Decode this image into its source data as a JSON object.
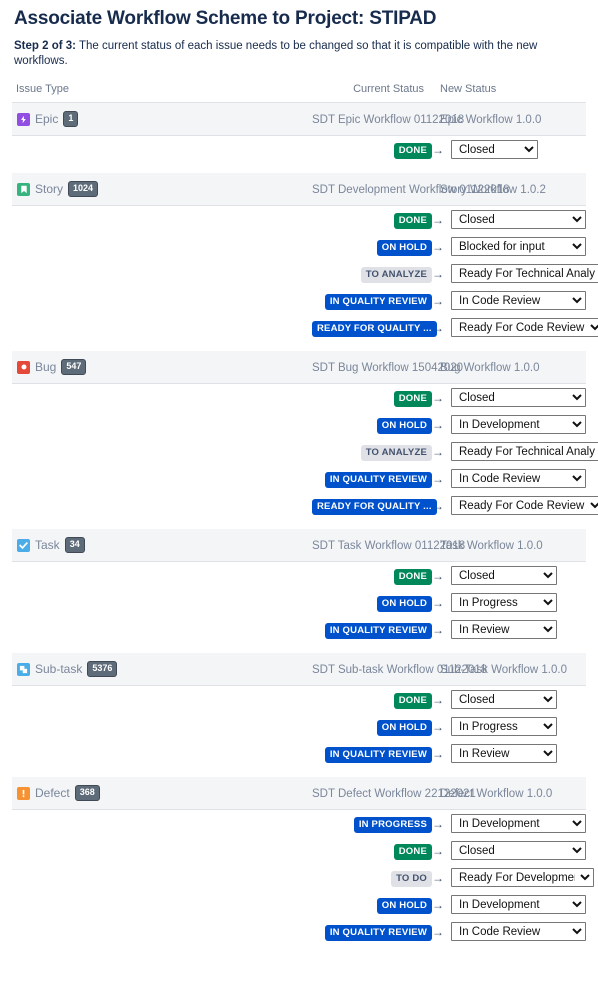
{
  "header": {
    "title": "Associate Workflow Scheme to Project: STIPAD",
    "step_label": "Step 2 of 3:",
    "step_text": " The current status of each issue needs to be changed so that it is compatible with the new workflows."
  },
  "columns": {
    "issue_type": "Issue Type",
    "current_status": "Current Status",
    "new_status": "New Status"
  },
  "colors": {
    "lozenge_green": "#00875a",
    "lozenge_blue": "#0052cc",
    "lozenge_grey": "#dfe1e6",
    "epic_icon": "#904ee2",
    "story_icon": "#36b37e",
    "bug_icon": "#e5493a",
    "task_icon": "#4bade8",
    "subtask_icon": "#4bade8",
    "defect_icon": "#f79232",
    "group_row_bg": "#f4f5f7",
    "muted_text": "#7a869a",
    "count_badge_bg": "#5e6c7a"
  },
  "groups": [
    {
      "type": "Epic",
      "icon": "epic-icon",
      "count": "1",
      "current_workflow": "SDT Epic Workflow 01122018",
      "new_workflow": "Epic Workflow 1.0.0",
      "select_width": "w-sm",
      "mappings": [
        {
          "status": "DONE",
          "tone": "green",
          "new_status": "Closed"
        }
      ]
    },
    {
      "type": "Story",
      "icon": "story-icon",
      "count": "1024",
      "current_workflow": "SDT Development Workflow 01122018",
      "new_workflow": "Story Workflow 1.0.2",
      "select_width": "w-xl",
      "mappings": [
        {
          "status": "DONE",
          "tone": "green",
          "new_status": "Closed"
        },
        {
          "status": "ON HOLD",
          "tone": "blue",
          "new_status": "Blocked for input"
        },
        {
          "status": "TO ANALYZE",
          "tone": "grey",
          "new_status": "Ready For Technical Analysis"
        },
        {
          "status": "IN QUALITY REVIEW",
          "tone": "blue",
          "new_status": "In Code Review"
        },
        {
          "status": "READY FOR QUALITY ...",
          "tone": "blue",
          "new_status": "Ready For Code Review"
        }
      ]
    },
    {
      "type": "Bug",
      "icon": "bug-icon",
      "count": "547",
      "current_workflow": "SDT Bug Workflow 15042020",
      "new_workflow": "Bug Workflow 1.0.0",
      "select_width": "w-xl",
      "mappings": [
        {
          "status": "DONE",
          "tone": "green",
          "new_status": "Closed"
        },
        {
          "status": "ON HOLD",
          "tone": "blue",
          "new_status": "In Development"
        },
        {
          "status": "TO ANALYZE",
          "tone": "grey",
          "new_status": "Ready For Technical Analysis"
        },
        {
          "status": "IN QUALITY REVIEW",
          "tone": "blue",
          "new_status": "In Code Review"
        },
        {
          "status": "READY FOR QUALITY ...",
          "tone": "blue",
          "new_status": "Ready For Code Review"
        }
      ]
    },
    {
      "type": "Task",
      "icon": "task-icon",
      "count": "34",
      "current_workflow": "SDT Task Workflow 01122018",
      "new_workflow": "Task Workflow 1.0.0",
      "select_width": "w-md",
      "mappings": [
        {
          "status": "DONE",
          "tone": "green",
          "new_status": "Closed"
        },
        {
          "status": "ON HOLD",
          "tone": "blue",
          "new_status": "In Progress"
        },
        {
          "status": "IN QUALITY REVIEW",
          "tone": "blue",
          "new_status": "In Review"
        }
      ]
    },
    {
      "type": "Sub-task",
      "icon": "subtask-icon",
      "count": "5376",
      "current_workflow": "SDT Sub-task Workflow 01122018",
      "new_workflow": "Sub-Task Workflow 1.0.0",
      "select_width": "w-md",
      "mappings": [
        {
          "status": "DONE",
          "tone": "green",
          "new_status": "Closed"
        },
        {
          "status": "ON HOLD",
          "tone": "blue",
          "new_status": "In Progress"
        },
        {
          "status": "IN QUALITY REVIEW",
          "tone": "blue",
          "new_status": "In Review"
        }
      ]
    },
    {
      "type": "Defect",
      "icon": "defect-icon",
      "count": "368",
      "current_workflow": "SDT Defect Workflow 22122021",
      "new_workflow": "Defect Workflow 1.0.0",
      "select_width": "w-lg",
      "mappings": [
        {
          "status": "IN PROGRESS",
          "tone": "blue",
          "new_status": "In Development"
        },
        {
          "status": "DONE",
          "tone": "green",
          "new_status": "Closed"
        },
        {
          "status": "TO DO",
          "tone": "grey",
          "new_status": "Ready For Development"
        },
        {
          "status": "ON HOLD",
          "tone": "blue",
          "new_status": "In Development"
        },
        {
          "status": "IN QUALITY REVIEW",
          "tone": "blue",
          "new_status": "In Code Review"
        }
      ]
    }
  ],
  "arrow_glyph": "→"
}
